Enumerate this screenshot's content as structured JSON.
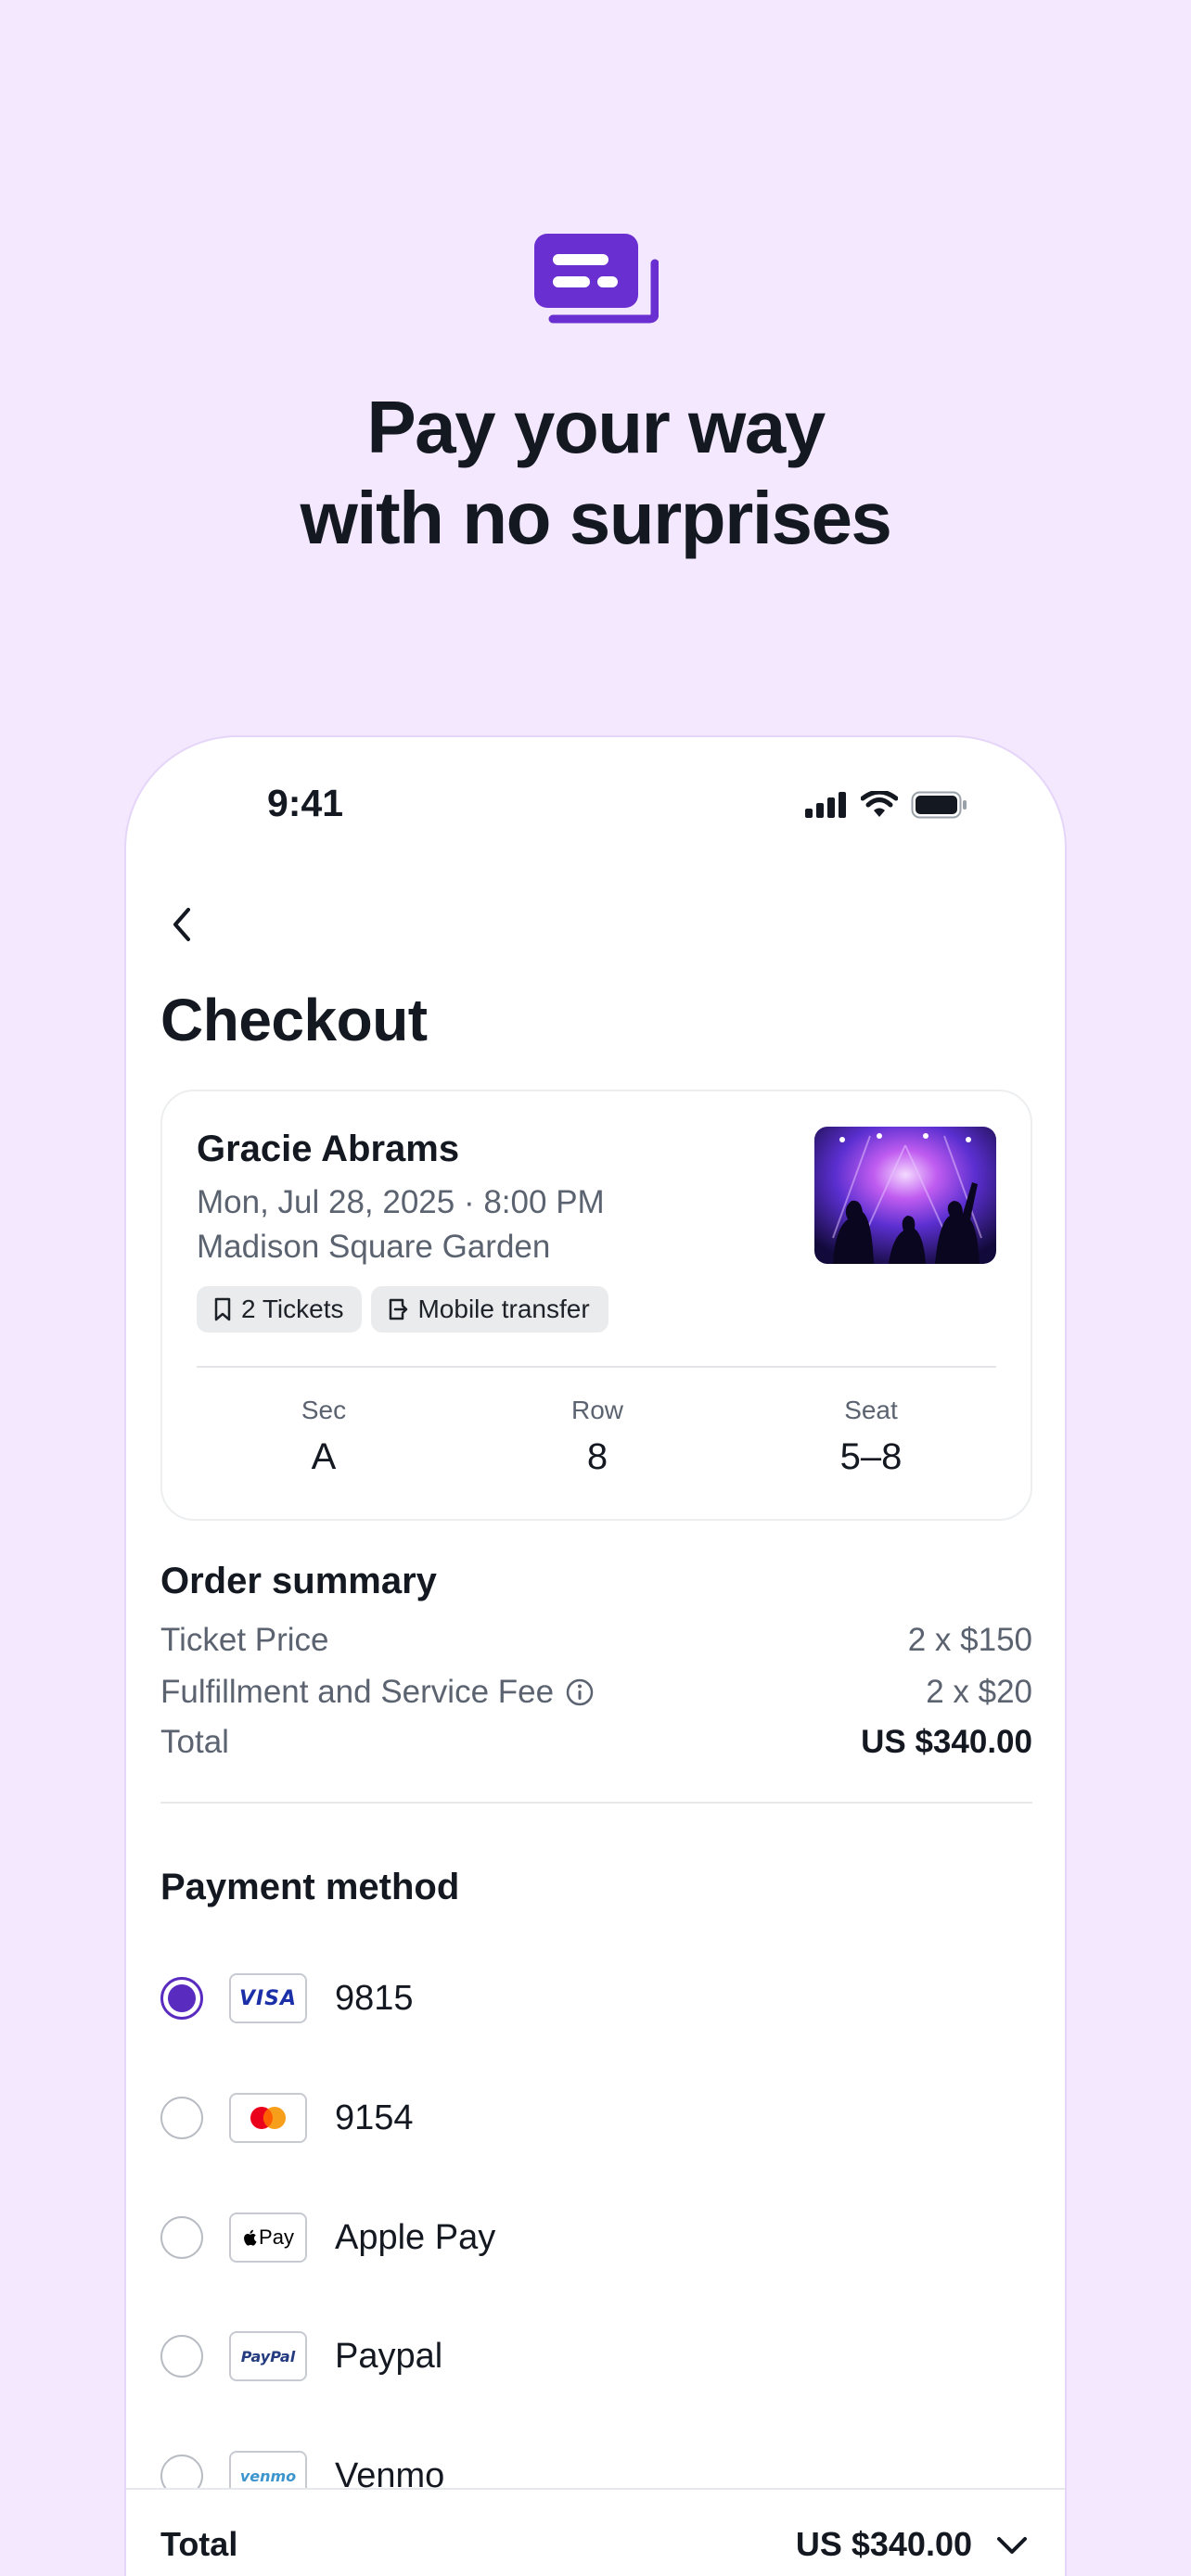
{
  "promo": {
    "headline_line1": "Pay your way",
    "headline_line2": "with no surprises",
    "icon": "ticket-stack-icon"
  },
  "status_bar": {
    "time": "9:41",
    "icons": [
      "signal-icon",
      "wifi-icon",
      "battery-icon"
    ]
  },
  "page": {
    "title": "Checkout",
    "back_icon": "chevron-left-icon"
  },
  "event": {
    "name": "Gracie Abrams",
    "date": "Mon, Jul 28, 2025 · 8:00 PM",
    "venue": "Madison Square Garden",
    "chips": [
      {
        "icon": "bookmark-icon",
        "label": "2 Tickets"
      },
      {
        "icon": "transfer-icon",
        "label": "Mobile transfer"
      }
    ],
    "seat_info": [
      {
        "label": "Sec",
        "value": "A"
      },
      {
        "label": "Row",
        "value": "8"
      },
      {
        "label": "Seat",
        "value": "5–8"
      }
    ]
  },
  "order_summary": {
    "title": "Order summary",
    "rows": [
      {
        "label": "Ticket Price",
        "value": "2 x $150"
      },
      {
        "label": "Fulfillment and Service Fee",
        "value": "2 x $20"
      },
      {
        "label": "Total",
        "value": "US $340.00"
      }
    ]
  },
  "payment": {
    "title": "Payment method",
    "options": [
      {
        "logo": "VISA",
        "label": "9815",
        "selected": true
      },
      {
        "logo": "mastercard",
        "label": "9154",
        "selected": false
      },
      {
        "logo": "Pay",
        "label": "Apple Pay",
        "selected": false
      },
      {
        "logo": "PayPal",
        "label": "Paypal",
        "selected": false
      },
      {
        "logo": "venmo",
        "label": "Venmo",
        "selected": false
      }
    ]
  },
  "bottom_bar": {
    "label": "Total",
    "value": "US $340.00"
  },
  "colors": {
    "background": "#f3e8fe",
    "accent": "#5a2bbf",
    "icon_purple": "#6a2fd1",
    "text": "#141821",
    "muted": "#5c6370"
  }
}
